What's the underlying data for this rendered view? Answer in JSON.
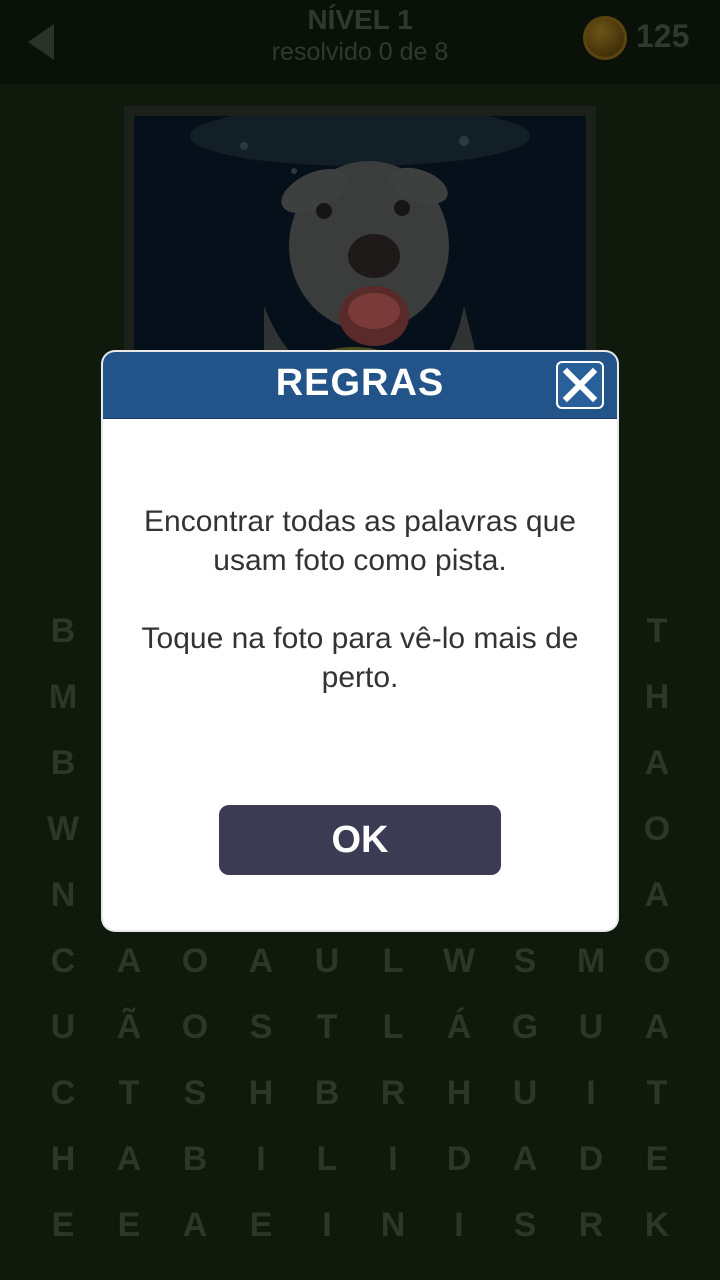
{
  "header": {
    "level_title": "NÍVEL 1",
    "progress_text": "resolvido 0 de 8",
    "coins": "125"
  },
  "icons": {
    "back": "back-arrow-icon",
    "coin": "coin-icon",
    "close": "close-icon"
  },
  "grid": {
    "rows": [
      [
        "B",
        "",
        "",
        "",
        "",
        "",
        "",
        "",
        "",
        "T"
      ],
      [
        "M",
        "",
        "",
        "",
        "",
        "",
        "",
        "",
        "",
        "H"
      ],
      [
        "B",
        "",
        "",
        "",
        "",
        "",
        "",
        "",
        "",
        "A"
      ],
      [
        "W",
        "",
        "",
        "",
        "",
        "",
        "",
        "",
        "",
        "O"
      ],
      [
        "N",
        "",
        "",
        "",
        "",
        "",
        "",
        "",
        "",
        "A"
      ],
      [
        "C",
        "A",
        "O",
        "A",
        "U",
        "L",
        "W",
        "S",
        "M",
        "O"
      ],
      [
        "U",
        "Ã",
        "O",
        "S",
        "T",
        "L",
        "Á",
        "G",
        "U",
        "A"
      ],
      [
        "C",
        "T",
        "S",
        "H",
        "B",
        "R",
        "H",
        "U",
        "I",
        "T"
      ],
      [
        "H",
        "A",
        "B",
        "I",
        "L",
        "I",
        "D",
        "A",
        "D",
        "E"
      ],
      [
        "E",
        "E",
        "A",
        "E",
        "I",
        "N",
        "I",
        "S",
        "R",
        "K"
      ]
    ]
  },
  "modal": {
    "title": "REGRAS",
    "paragraph1": "Encontrar todas as palavras que usam foto como pista.",
    "paragraph2": "Toque na foto para vê-lo mais de perto.",
    "ok_label": "OK"
  },
  "colors": {
    "modal_header": "#225389",
    "ok_button": "#3b3c53",
    "background": "#0f1a0d"
  }
}
